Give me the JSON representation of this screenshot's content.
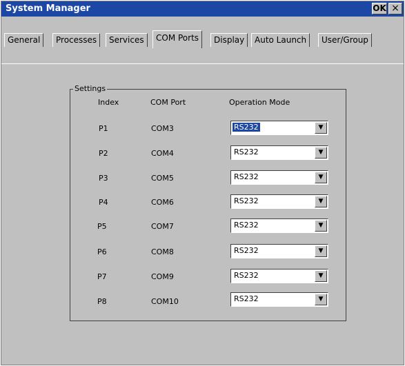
{
  "window": {
    "title": "System Manager",
    "ok_label": "OK",
    "close_label": "×"
  },
  "tabs": [
    {
      "label": "General",
      "active": false
    },
    {
      "label": "Processes",
      "active": false
    },
    {
      "label": "Services",
      "active": false
    },
    {
      "label": "COM Ports",
      "active": true
    },
    {
      "label": "Display",
      "active": false
    },
    {
      "label": "Auto Launch",
      "active": false
    },
    {
      "label": "User/Group",
      "active": false
    }
  ],
  "settings": {
    "group_label": "Settings",
    "headers": {
      "index": "Index",
      "com_port": "COM Port",
      "operation_mode": "Operation Mode"
    },
    "rows": [
      {
        "index": "P1",
        "port": "COM3",
        "mode": "RS232",
        "selected": true
      },
      {
        "index": "P2",
        "port": "COM4",
        "mode": "RS232",
        "selected": false
      },
      {
        "index": "P3",
        "port": "COM5",
        "mode": "RS232",
        "selected": false
      },
      {
        "index": "P4",
        "port": "COM6",
        "mode": "RS232",
        "selected": false
      },
      {
        "index": "P5",
        "port": "COM7",
        "mode": "RS232",
        "selected": false
      },
      {
        "index": "P6",
        "port": "COM8",
        "mode": "RS232",
        "selected": false
      },
      {
        "index": "P7",
        "port": "COM9",
        "mode": "RS232",
        "selected": false
      },
      {
        "index": "P8",
        "port": "COM10",
        "mode": "RS232",
        "selected": false
      }
    ],
    "dropdown_icon": "triangle-down-icon"
  },
  "colors": {
    "titlebar": "#1c47a5",
    "face": "#c0c0c0",
    "selection": "#1c47a5"
  }
}
